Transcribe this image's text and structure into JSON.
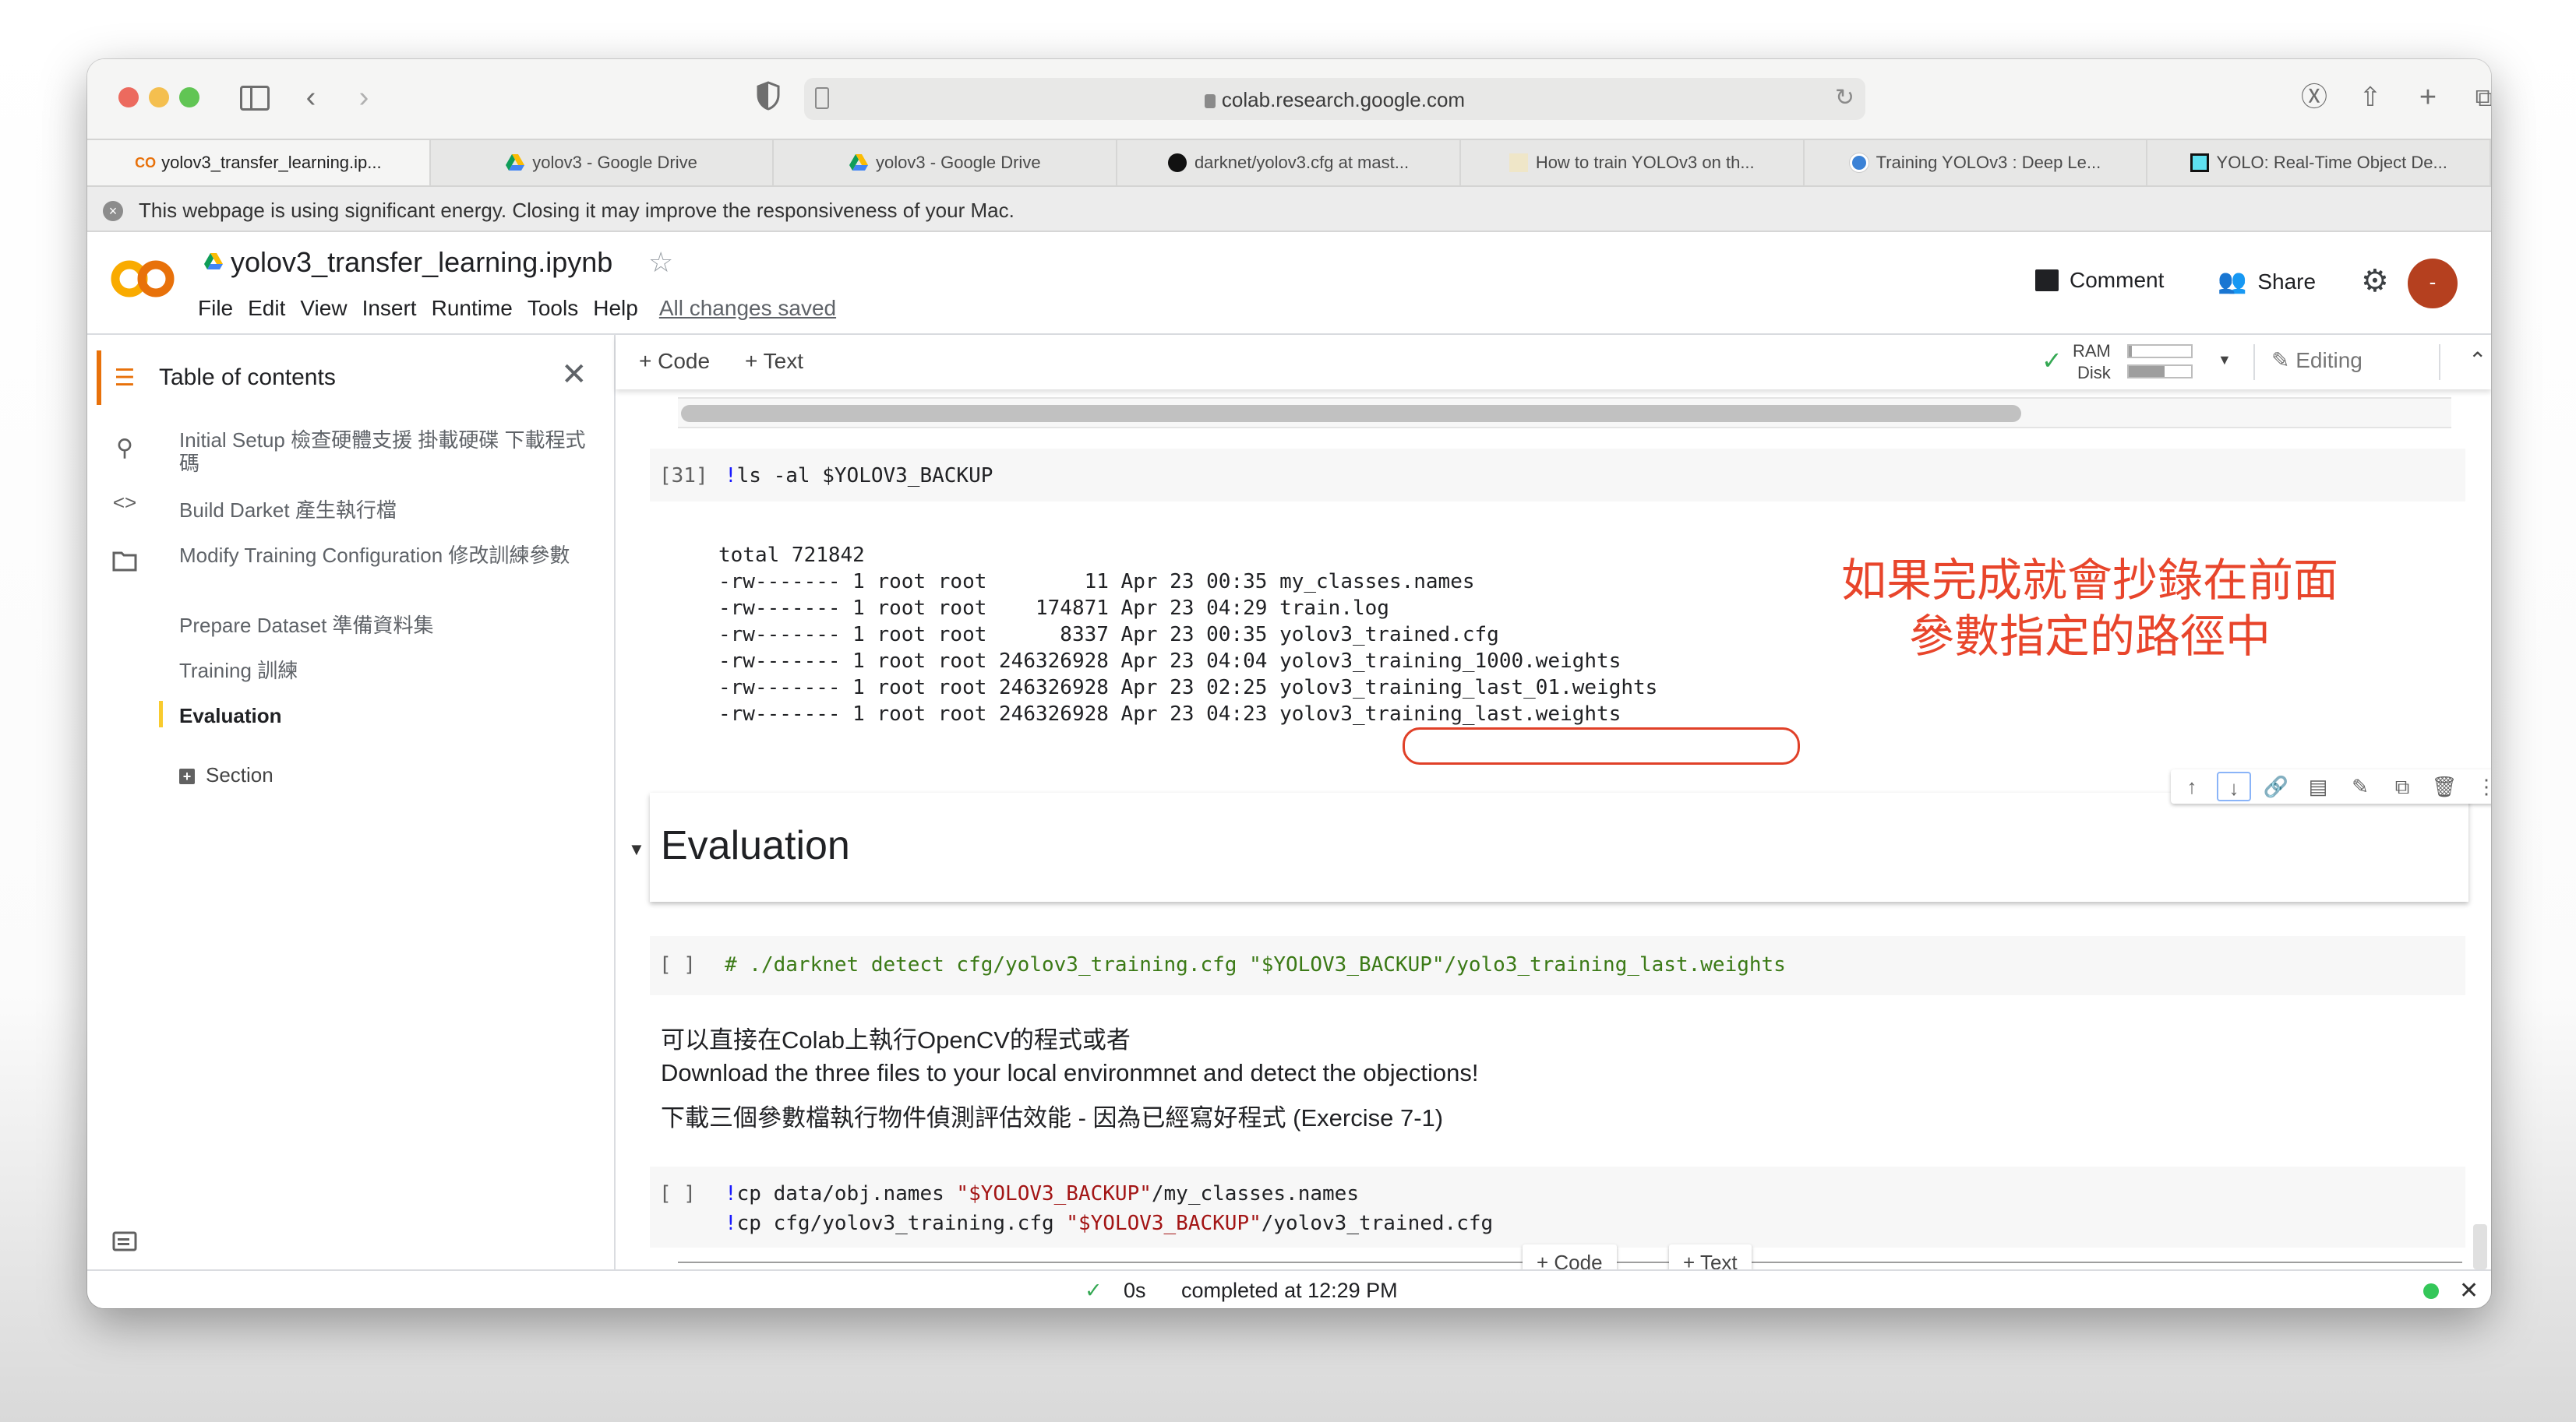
{
  "browser": {
    "url": "colab.research.google.com",
    "tabs": [
      {
        "label": "yolov3_transfer_learning.ip...",
        "icon": "colab-icon",
        "active": true
      },
      {
        "label": "yolov3 - Google Drive",
        "icon": "google-drive-icon",
        "active": false
      },
      {
        "label": "yolov3 - Google Drive",
        "icon": "google-drive-icon",
        "active": false
      },
      {
        "label": "darknet/yolov3.cfg at mast...",
        "icon": "github-icon",
        "active": false
      },
      {
        "label": "How to train YOLOv3 on th...",
        "icon": "article-icon",
        "active": false
      },
      {
        "label": "Training YOLOv3 : Deep Le...",
        "icon": "circle-site-icon",
        "active": false
      },
      {
        "label": "YOLO: Real-Time Object De...",
        "icon": "yolo-site-icon",
        "active": false
      }
    ],
    "energy_warning": "This webpage is using significant energy. Closing it may improve the responsiveness of your Mac."
  },
  "colab": {
    "notebook_title": "yolov3_transfer_learning.ipynb",
    "menu": [
      "File",
      "Edit",
      "View",
      "Insert",
      "Runtime",
      "Tools",
      "Help"
    ],
    "save_status": "All changes saved",
    "comment_label": "Comment",
    "share_label": "Share",
    "avatar_text": "-",
    "avatar_color": "#b5401f",
    "add_code_label": "+ Code",
    "add_text_label": "+ Text",
    "ram_label": "RAM",
    "disk_label": "Disk",
    "ram_usage_percent": 5,
    "disk_usage_percent": 57,
    "editing_label": "Editing"
  },
  "sidebar": {
    "title": "Table of contents",
    "items": [
      {
        "label": "Initial Setup 檢查硬體支援 掛載硬碟 下載程式碼",
        "active": false
      },
      {
        "label": "Build Darket 產生執行檔",
        "active": false
      },
      {
        "label": "Modify Training Configuration 修改訓練參數",
        "active": false
      },
      {
        "label": "Prepare Dataset 準備資料集",
        "active": false
      },
      {
        "label": "Training 訓練",
        "active": false
      },
      {
        "label": "Evaluation",
        "active": true
      }
    ],
    "section_label": "Section"
  },
  "cells": {
    "ls_cell": {
      "exec_count": "[31]",
      "command": "ls -al $YOLOV3_BACKUP",
      "output": {
        "total": "total 721842",
        "rows": [
          {
            "perms": "-rw-------",
            "links": "1",
            "owner": "root",
            "group": "root",
            "size": "11",
            "date": "Apr 23 00:35",
            "name": "my_classes.names"
          },
          {
            "perms": "-rw-------",
            "links": "1",
            "owner": "root",
            "group": "root",
            "size": "174871",
            "date": "Apr 23 04:29",
            "name": "train.log"
          },
          {
            "perms": "-rw-------",
            "links": "1",
            "owner": "root",
            "group": "root",
            "size": "8337",
            "date": "Apr 23 00:35",
            "name": "yolov3_trained.cfg"
          },
          {
            "perms": "-rw-------",
            "links": "1",
            "owner": "root",
            "group": "root",
            "size": "246326928",
            "date": "Apr 23 04:04",
            "name": "yolov3_training_1000.weights"
          },
          {
            "perms": "-rw-------",
            "links": "1",
            "owner": "root",
            "group": "root",
            "size": "246326928",
            "date": "Apr 23 02:25",
            "name": "yolov3_training_last_01.weights"
          },
          {
            "perms": "-rw-------",
            "links": "1",
            "owner": "root",
            "group": "root",
            "size": "246326928",
            "date": "Apr 23 04:23",
            "name": "yolov3_training_last.weights"
          }
        ]
      }
    },
    "annotation": {
      "line1": "如果完成就會抄錄在前面",
      "line2": "參數指定的路徑中",
      "color": "#e8452b"
    },
    "evaluation_heading": "Evaluation",
    "detect_cell": {
      "exec_count": "[ ]",
      "code": "# ./darknet detect cfg/yolov3_training.cfg \"$YOLOV3_BACKUP\"/yolo3_training_last.weights"
    },
    "markdown": {
      "line1": "可以直接在Colab上執行OpenCV的程式或者",
      "line2": "Download the three files to your local environmnet and detect the objections!",
      "line3": "下載三個參數檔執行物件偵測評估效能 - 因為已經寫好程式 (Exercise 7-1)"
    },
    "cp_cell": {
      "exec_count": "[ ]",
      "line1_cmd": "cp data/obj.names ",
      "line1_str": "\"$YOLOV3_BACKUP\"",
      "line1_rest": "/my_classes.names",
      "line2_cmd": "cp cfg/yolov3_training.cfg ",
      "line2_str": "\"$YOLOV3_BACKUP\"",
      "line2_rest": "/yolov3_trained.cfg"
    },
    "empty_cell": {
      "exec_count": "[ ]"
    }
  },
  "statusbar": {
    "duration": "0s",
    "completed": "completed at 12:29 PM"
  }
}
